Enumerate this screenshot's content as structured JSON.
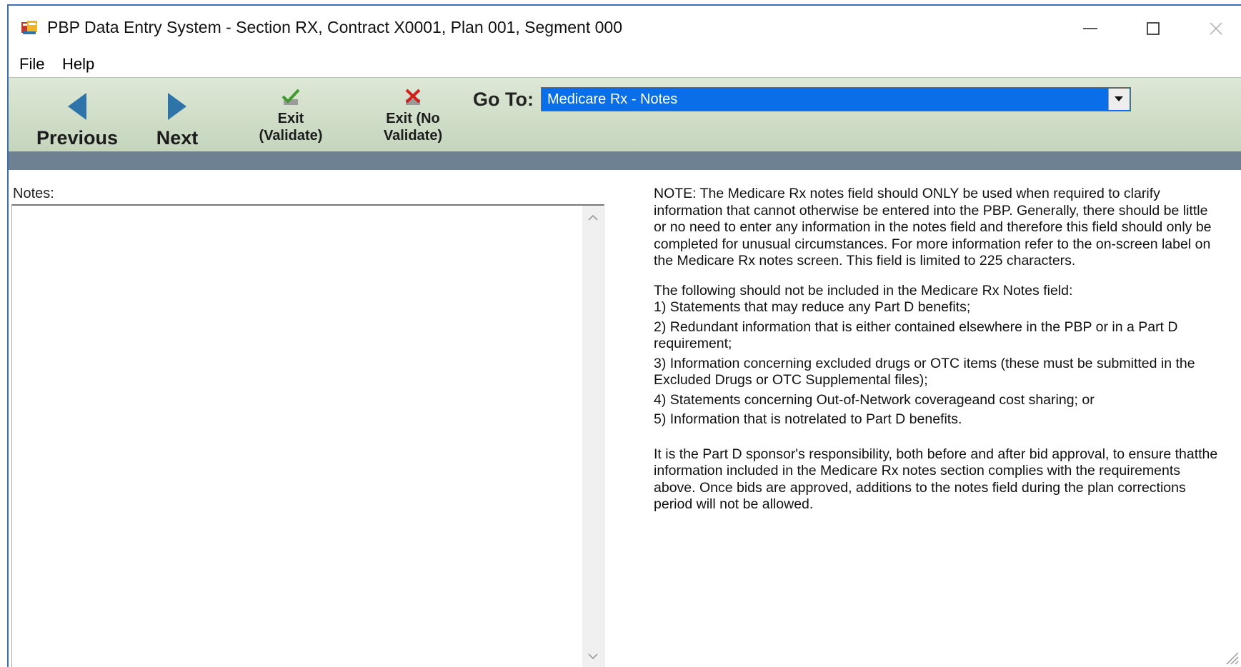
{
  "window": {
    "title": "PBP Data Entry System - Section RX, Contract X0001, Plan 001, Segment 000",
    "icon": "app-window-icon",
    "controls": [
      "minimize-icon",
      "maximize-icon",
      "close-icon"
    ]
  },
  "menu": {
    "file": "File",
    "help": "Help"
  },
  "toolbar": {
    "previous_label": "Previous",
    "next_label": "Next",
    "exit_validate_line1": "Exit",
    "exit_validate_line2": "(Validate)",
    "exit_novalidate_line1": "Exit (No",
    "exit_novalidate_line2": "Validate)",
    "goto_label": "Go To:",
    "goto_value": "Medicare Rx - Notes"
  },
  "notes": {
    "label": "Notes:",
    "value": ""
  },
  "info": {
    "note": "NOTE: The Medicare Rx notes field should ONLY be used when required to clarify information that cannot otherwise be entered into the PBP. Generally, there should be little or no need to enter any information in the notes field and therefore this field should only be completed for unusual circumstances. For more information refer to the on-screen label on the Medicare Rx notes screen. This field is limited to 225 characters.",
    "intro": "The following should not be included in the Medicare Rx Notes field:",
    "items": [
      "1) Statements that may reduce any Part D benefits;",
      "2) Redundant information that is either contained elsewhere in the PBP or in a Part D requirement;",
      "3) Information concerning excluded drugs or OTC items (these must be submitted in the Excluded Drugs or OTC Supplemental files);",
      "4) Statements concerning Out-of-Network coverageand cost sharing; or",
      "5) Information that is notrelated to Part D benefits."
    ],
    "closing": "It is the Part D sponsor's responsibility, both before and after bid approval, to ensure thatthe information included in the Medicare Rx notes section complies with the requirements above. Once bids are approved, additions to the notes field during the plan corrections period will not be allowed."
  },
  "colors": {
    "window_border": "#3c6fb0",
    "toolbar_bg": "#d2dfca",
    "separator": "#6e8193",
    "nav_arrow": "#2f74a8",
    "select_highlight": "#0a6ee8"
  }
}
